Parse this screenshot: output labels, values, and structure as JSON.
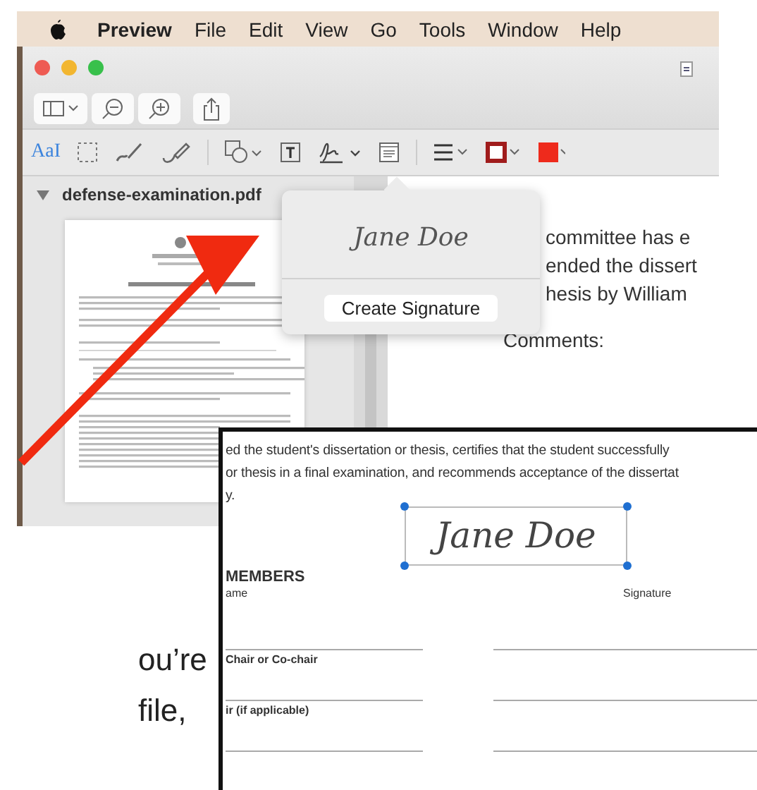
{
  "menu_bar": {
    "app_name": "Preview",
    "menus": [
      "File",
      "Edit",
      "View",
      "Go",
      "Tools",
      "Window",
      "Help"
    ]
  },
  "markup_toolbar": {
    "text_tool": "AaI",
    "text_tool_selected": true
  },
  "sidebar": {
    "file": "defense-examination.pdf",
    "expanded": true
  },
  "signature_popover": {
    "signature": "Jane Doe",
    "button": "Create Signature"
  },
  "document": {
    "lines": [
      "committee has e",
      "ended the dissert",
      "hesis by William"
    ],
    "comments_label": "Comments:"
  },
  "zoom_inset": {
    "lines": [
      "ed the student's dissertation or thesis, certifies that the student successfully",
      "or thesis in a final examination, and recommends acceptance of the dissertat",
      "y."
    ],
    "signature": "Jane Doe",
    "signature_selected": true,
    "heading": "MEMBERS",
    "name_column": "ame",
    "signature_column": "Signature",
    "rows": [
      "",
      "Chair or Co-chair",
      "ir (if applicable)"
    ]
  },
  "caption": [
    "ou’re",
    "file,"
  ]
}
